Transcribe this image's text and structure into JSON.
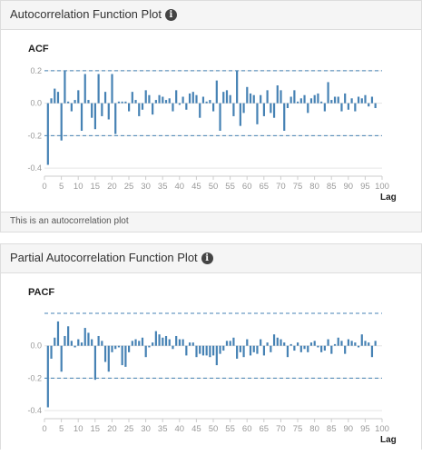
{
  "acf_panel": {
    "title": "Autocorrelation Function Plot",
    "info_glyph": "i",
    "footer_text": "This is an autocorrelation plot"
  },
  "pacf_panel": {
    "title": "Partial Autocorrelation Function Plot",
    "info_glyph": "i"
  },
  "colors": {
    "bar": "#4682b4",
    "confidence_line": "#4682b4",
    "grid": "#e5e5e5",
    "axis": "#cccccc"
  },
  "chart_data": [
    {
      "type": "bar",
      "title": "ACF",
      "xlabel": "Lag",
      "ylabel": "",
      "xlim": [
        0,
        100
      ],
      "ylim": [
        -0.45,
        0.25
      ],
      "x_ticks": [
        0,
        5,
        10,
        15,
        20,
        25,
        30,
        35,
        40,
        45,
        50,
        55,
        60,
        65,
        70,
        75,
        80,
        85,
        90,
        95,
        100
      ],
      "y_ticks": [
        -0.4,
        -0.2,
        0.0,
        0.2
      ],
      "y_tick_labels": [
        "-0.4",
        "-0.2",
        "0.0",
        "0.2"
      ],
      "confidence_band": [
        0.2,
        -0.2
      ],
      "lags": [
        1,
        2,
        3,
        4,
        5,
        6,
        7,
        8,
        9,
        10,
        11,
        12,
        13,
        14,
        15,
        16,
        17,
        18,
        19,
        20,
        21,
        22,
        23,
        24,
        25,
        26,
        27,
        28,
        29,
        30,
        31,
        32,
        33,
        34,
        35,
        36,
        37,
        38,
        39,
        40,
        41,
        42,
        43,
        44,
        45,
        46,
        47,
        48,
        49,
        50,
        51,
        52,
        53,
        54,
        55,
        56,
        57,
        58,
        59,
        60,
        61,
        62,
        63,
        64,
        65,
        66,
        67,
        68,
        69,
        70,
        71,
        72,
        73,
        74,
        75,
        76,
        77,
        78,
        79,
        80,
        81,
        82,
        83,
        84,
        85,
        86,
        87,
        88,
        89,
        90,
        91,
        92,
        93,
        94,
        95,
        96,
        97,
        98
      ],
      "values": [
        -0.38,
        0.03,
        0.09,
        0.07,
        -0.23,
        0.2,
        0.01,
        -0.05,
        0.02,
        0.08,
        -0.17,
        0.18,
        0.02,
        -0.09,
        -0.16,
        0.18,
        -0.08,
        0.07,
        -0.1,
        0.18,
        -0.19,
        0.01,
        0.01,
        0.01,
        -0.05,
        0.07,
        0.02,
        -0.08,
        -0.04,
        0.08,
        0.05,
        -0.07,
        0.02,
        0.05,
        0.04,
        0.02,
        0.03,
        -0.05,
        0.08,
        -0.01,
        0.04,
        -0.04,
        0.06,
        0.07,
        0.05,
        -0.09,
        0.04,
        0.01,
        0.02,
        -0.05,
        0.14,
        -0.17,
        0.07,
        0.08,
        0.05,
        -0.08,
        0.2,
        -0.14,
        -0.06,
        0.1,
        0.06,
        0.05,
        -0.13,
        0.05,
        -0.08,
        0.08,
        -0.06,
        -0.09,
        0.11,
        0.08,
        -0.17,
        -0.03,
        0.04,
        0.08,
        0.01,
        0.03,
        0.05,
        -0.06,
        0.03,
        0.05,
        0.06,
        0.01,
        -0.05,
        0.13,
        0.02,
        0.04,
        0.04,
        -0.05,
        0.06,
        -0.04,
        0.03,
        -0.05,
        0.04,
        0.03,
        0.05,
        -0.02,
        0.04,
        -0.03
      ]
    },
    {
      "type": "bar",
      "title": "PACF",
      "xlabel": "Lag",
      "ylabel": "",
      "xlim": [
        0,
        100
      ],
      "ylim": [
        -0.45,
        0.2
      ],
      "x_ticks": [
        0,
        5,
        10,
        15,
        20,
        25,
        30,
        35,
        40,
        45,
        50,
        55,
        60,
        65,
        70,
        75,
        80,
        85,
        90,
        95,
        100
      ],
      "y_ticks": [
        -0.4,
        -0.2,
        0.0
      ],
      "y_tick_labels": [
        "-0.4",
        "-0.2",
        "0.0"
      ],
      "confidence_band": [
        0.2,
        -0.2
      ],
      "lags": [
        1,
        2,
        3,
        4,
        5,
        6,
        7,
        8,
        9,
        10,
        11,
        12,
        13,
        14,
        15,
        16,
        17,
        18,
        19,
        20,
        21,
        22,
        23,
        24,
        25,
        26,
        27,
        28,
        29,
        30,
        31,
        32,
        33,
        34,
        35,
        36,
        37,
        38,
        39,
        40,
        41,
        42,
        43,
        44,
        45,
        46,
        47,
        48,
        49,
        50,
        51,
        52,
        53,
        54,
        55,
        56,
        57,
        58,
        59,
        60,
        61,
        62,
        63,
        64,
        65,
        66,
        67,
        68,
        69,
        70,
        71,
        72,
        73,
        74,
        75,
        76,
        77,
        78,
        79,
        80,
        81,
        82,
        83,
        84,
        85,
        86,
        87,
        88,
        89,
        90,
        91,
        92,
        93,
        94,
        95,
        96,
        97,
        98
      ],
      "values": [
        -0.38,
        -0.08,
        0.05,
        0.15,
        -0.16,
        0.06,
        0.12,
        0.03,
        -0.01,
        0.04,
        0.02,
        0.11,
        0.08,
        0.04,
        -0.21,
        0.06,
        0.03,
        -0.1,
        -0.16,
        -0.04,
        -0.02,
        -0.01,
        -0.12,
        -0.13,
        -0.04,
        0.03,
        0.04,
        0.03,
        0.05,
        -0.07,
        -0.01,
        0.02,
        0.09,
        0.07,
        0.05,
        0.06,
        0.04,
        -0.02,
        0.06,
        0.04,
        0.04,
        -0.06,
        0.02,
        0.02,
        -0.07,
        -0.05,
        -0.06,
        -0.06,
        -0.07,
        -0.06,
        -0.12,
        -0.05,
        -0.03,
        0.03,
        0.03,
        0.05,
        -0.08,
        -0.04,
        -0.07,
        0.04,
        -0.06,
        -0.04,
        -0.05,
        0.04,
        -0.06,
        0.02,
        -0.04,
        0.07,
        0.05,
        0.04,
        0.02,
        -0.07,
        0.01,
        -0.03,
        0.02,
        -0.04,
        -0.02,
        -0.04,
        0.02,
        0.03,
        -0.01,
        -0.04,
        -0.03,
        0.04,
        -0.05,
        0.01,
        0.05,
        0.03,
        -0.05,
        0.04,
        0.03,
        0.02,
        -0.01,
        0.07,
        0.03,
        0.02,
        -0.07,
        0.03
      ]
    }
  ]
}
